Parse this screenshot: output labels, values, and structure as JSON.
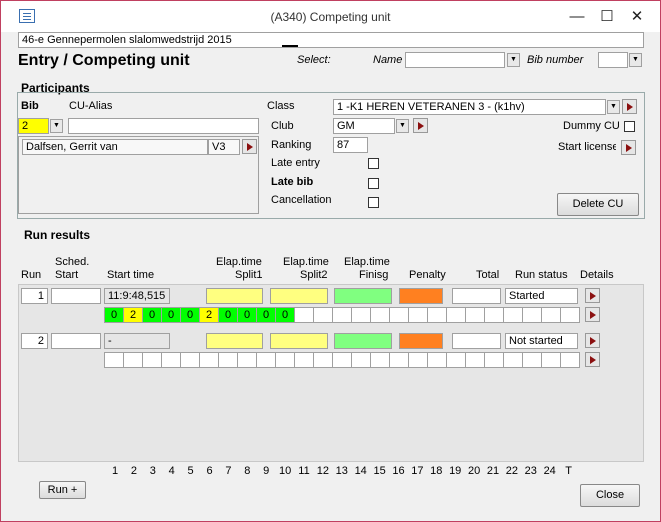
{
  "window": {
    "title": "(A340) Competing unit",
    "minimize": "—",
    "maximize": "☐",
    "close": "✕"
  },
  "event_name": "46-e Gennepermolen slalomwedstrijd 2015",
  "form_title": "Entry / Competing unit",
  "select": {
    "label": "Select:",
    "name_label": "Name",
    "name_value": "",
    "bib_label": "Bib number",
    "bib_value": ""
  },
  "participants": {
    "section_label": "Participants",
    "bib_label": "Bib",
    "bib_value": "2",
    "alias_label": "CU-Alias",
    "alias_value": "",
    "person_name": "Dalfsen, Gerrit van",
    "person_code": "V3",
    "class_label": "Class",
    "class_value": "1 -K1  HEREN VETERANEN 3 - (k1hv)",
    "club_label": "Club",
    "club_value": "GM",
    "ranking_label": "Ranking",
    "ranking_value": "87",
    "late_entry_label": "Late entry",
    "late_bib_label": "Late bib",
    "cancellation_label": "Cancellation",
    "dummy_label": "Dummy CU",
    "start_license_label": "Start license",
    "delete_label": "Delete CU"
  },
  "run_results": {
    "section_label": "Run results",
    "headers": {
      "run": "Run",
      "sched": "Sched.",
      "sched2": "Start",
      "start_time": "Start time",
      "split1a": "Elap.time",
      "split1b": "Split1",
      "split2a": "Elap.time",
      "split2b": "Split2",
      "finisha": "Elap.time",
      "finishb": "Finisg",
      "penalty": "Penalty",
      "total": "Total",
      "status": "Run status",
      "details": "Details"
    },
    "runs": [
      {
        "run": "1",
        "start_time": "11:9:48,515",
        "status": "Started",
        "gates": [
          "0",
          "2",
          "0",
          "0",
          "0",
          "2",
          "0",
          "0",
          "0",
          "0"
        ]
      },
      {
        "run": "2",
        "start_time": "-",
        "status": "Not started",
        "gates": []
      }
    ],
    "gate_numbers": [
      "1",
      "2",
      "3",
      "4",
      "5",
      "6",
      "7",
      "8",
      "9",
      "10",
      "11",
      "12",
      "13",
      "14",
      "15",
      "16",
      "17",
      "18",
      "19",
      "20",
      "21",
      "22",
      "23",
      "24",
      "T"
    ]
  },
  "buttons": {
    "run_plus": "Run +",
    "close": "Close"
  },
  "colors": {
    "split1": "#ffff80",
    "split2": "#ffff80",
    "finish": "#80ff80",
    "penalty": "#ff8020",
    "gate_green": "#00ff00",
    "gate_yellow": "#ffff00"
  }
}
